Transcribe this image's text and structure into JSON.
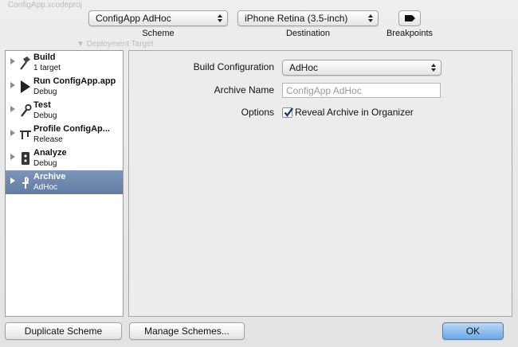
{
  "background": {
    "window_title": "ConfigApp.xcodeproj",
    "section": "▼ Deployment Target"
  },
  "toolbar": {
    "scheme_value": "ConfigApp AdHoc",
    "scheme_label": "Scheme",
    "destination_value": "iPhone Retina (3.5-inch)",
    "destination_label": "Destination",
    "breakpoints_label": "Breakpoints"
  },
  "sidebar": {
    "items": [
      {
        "name": "Build",
        "sub": "1 target",
        "icon": "hammer-icon",
        "selected": false
      },
      {
        "name": "Run ConfigApp.app",
        "sub": "Debug",
        "icon": "play-icon",
        "selected": false
      },
      {
        "name": "Test",
        "sub": "Debug",
        "icon": "wrench-icon",
        "selected": false
      },
      {
        "name": "Profile ConfigAp...",
        "sub": "Release",
        "icon": "caliper-icon",
        "selected": false
      },
      {
        "name": "Analyze",
        "sub": "Debug",
        "icon": "analyze-icon",
        "selected": false
      },
      {
        "name": "Archive",
        "sub": "AdHoc",
        "icon": "archive-icon",
        "selected": true
      }
    ]
  },
  "form": {
    "build_config_label": "Build Configuration",
    "build_config_value": "AdHoc",
    "archive_name_label": "Archive Name",
    "archive_name_placeholder": "ConfigApp AdHoc",
    "options_label": "Options",
    "reveal_label": "Reveal Archive in Organizer",
    "reveal_checked": true
  },
  "buttons": {
    "duplicate": "Duplicate Scheme",
    "manage": "Manage Schemes...",
    "ok": "OK"
  },
  "colors": {
    "selection": "#6d86ad",
    "ok_button": "#6aa7e4"
  }
}
